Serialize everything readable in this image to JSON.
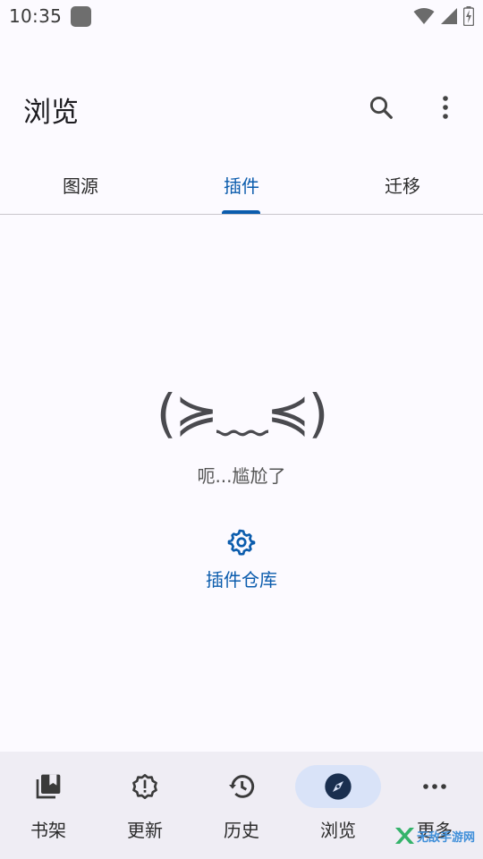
{
  "status_bar": {
    "time": "10:35",
    "icons": [
      "wifi-icon",
      "signal-icon",
      "battery-icon"
    ]
  },
  "app_bar": {
    "title": "浏览",
    "actions": [
      "search-icon",
      "more-vert-icon"
    ]
  },
  "tabs": [
    {
      "label": "图源",
      "active": false
    },
    {
      "label": "插件",
      "active": true
    },
    {
      "label": "迁移",
      "active": false
    }
  ],
  "empty_state": {
    "face": "(≽﹏≼)",
    "message": "呃...尴尬了",
    "action_label": "插件仓库",
    "action_icon": "gear-icon"
  },
  "bottom_nav": [
    {
      "label": "书架",
      "icon": "bookmark-collection-icon",
      "active": false
    },
    {
      "label": "更新",
      "icon": "alert-badge-icon",
      "active": false
    },
    {
      "label": "历史",
      "icon": "history-icon",
      "active": false
    },
    {
      "label": "浏览",
      "icon": "compass-icon",
      "active": true
    },
    {
      "label": "更多",
      "icon": "more-horiz-icon",
      "active": false
    }
  ],
  "watermark": {
    "text": "无敌手游网"
  },
  "colors": {
    "accent": "#0b5cad",
    "background": "#fcfaff",
    "nav_background": "#efedf4",
    "active_pill": "#d9e3f8"
  }
}
